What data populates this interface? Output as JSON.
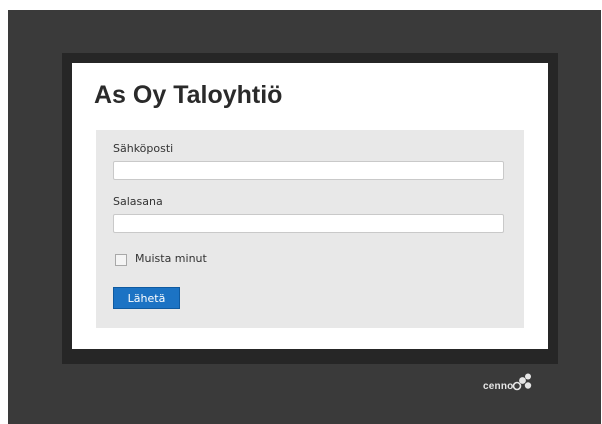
{
  "page": {
    "title": "As Oy Taloyhtiö"
  },
  "form": {
    "email": {
      "label": "Sähköposti",
      "value": ""
    },
    "password": {
      "label": "Salasana",
      "value": ""
    },
    "remember": {
      "label": "Muista minut",
      "checked": false
    },
    "submit_label": "Lähetä"
  },
  "footer": {
    "logo_text": "cenno"
  },
  "colors": {
    "background": "#3a3a3a",
    "frame": "#262626",
    "card": "#ffffff",
    "form_panel": "#e8e8e8",
    "button": "#1c73c4",
    "logo": "#e6e6e6"
  },
  "icons": {
    "checkbox": "checkbox-icon",
    "logo_mark": "cenno-logo-icon"
  }
}
